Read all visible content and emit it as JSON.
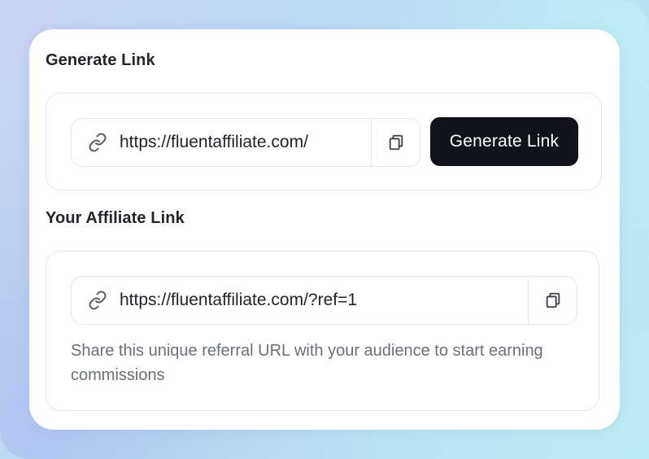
{
  "generate_section": {
    "title": "Generate Link",
    "url_value": "https://fluentaffiliate.com/",
    "button_label": "Generate Link"
  },
  "affiliate_section": {
    "title": "Your Affiliate Link",
    "url_value": "https://fluentaffiliate.com/?ref=1",
    "help_text": "Share this unique referral URL with your audience to start earning commissions"
  },
  "icons": {
    "link": "link-icon",
    "copy": "copy-icon"
  },
  "colors": {
    "primary_button": "#101319",
    "border": "#e4e6ea",
    "muted_text": "#6b6f78"
  }
}
